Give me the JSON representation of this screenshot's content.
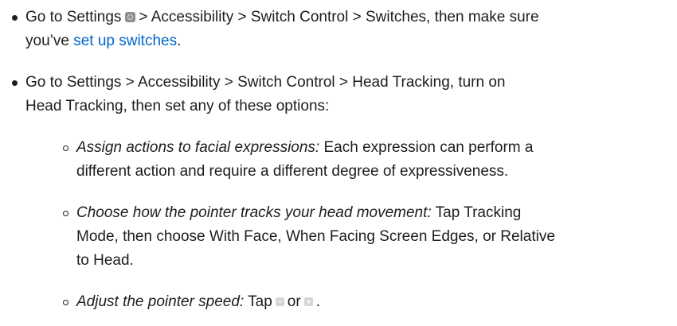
{
  "steps": [
    {
      "line1_prefix": "Go to Settings",
      "line1_suffix": "> Accessibility > Switch Control > Switches, then make sure",
      "line2_prefix": "you’ve ",
      "link": "set up switches",
      "line2_suffix": "."
    },
    {
      "line1": "Go to Settings > Accessibility > Switch Control > Head Tracking, turn on",
      "line2": "Head Tracking, then set any of these options:"
    }
  ],
  "options": [
    {
      "title": "Assign actions to facial expressions:",
      "line1_rest": " Each expression can perform a",
      "line2": "different action and require a different degree of expressiveness."
    },
    {
      "title": "Choose how the pointer tracks your head movement:",
      "line1_rest": " Tap Tracking",
      "line2": "Mode, then choose With Face, When Facing Screen Edges, or Relative",
      "line3": "to Head."
    },
    {
      "title": "Adjust the pointer speed:",
      "rest_prefix": " Tap",
      "rest_middle": "or",
      "rest_suffix": "."
    }
  ],
  "icons": {
    "settings": "settings-gear-icon",
    "decrease": "minus-icon",
    "increase": "plus-icon"
  },
  "colors": {
    "text": "#1d1d1f",
    "link": "#0066cc",
    "icon_gray": "#8e8e93"
  }
}
